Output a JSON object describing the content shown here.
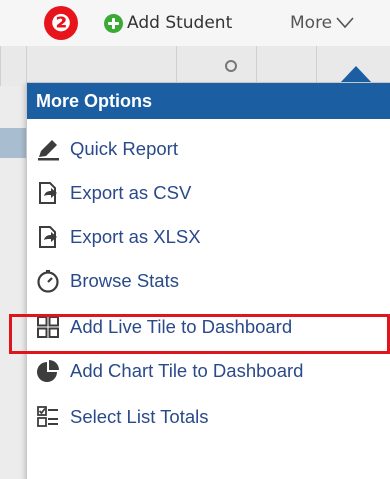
{
  "toolbar": {
    "step_badge": "❷",
    "add_student_label": "Add Student",
    "more_label": "More"
  },
  "menu": {
    "header": "More Options",
    "items": [
      {
        "label": "Quick Report",
        "icon": "pencil-icon"
      },
      {
        "label": "Export as CSV",
        "icon": "export-icon"
      },
      {
        "label": "Export as XLSX",
        "icon": "export-icon"
      },
      {
        "label": "Browse Stats",
        "icon": "gauge-icon"
      },
      {
        "label": "Add Live Tile to Dashboard",
        "icon": "tiles-icon"
      },
      {
        "label": "Add Chart Tile to Dashboard",
        "icon": "pie-chart-icon"
      },
      {
        "label": "Select List Totals",
        "icon": "checklist-icon"
      }
    ]
  },
  "colors": {
    "menu_header": "#1b5fa2",
    "menu_text": "#2a4a8a",
    "highlight": "#e0141b",
    "add_icon": "#3aa935",
    "badge": "#e8141b"
  }
}
